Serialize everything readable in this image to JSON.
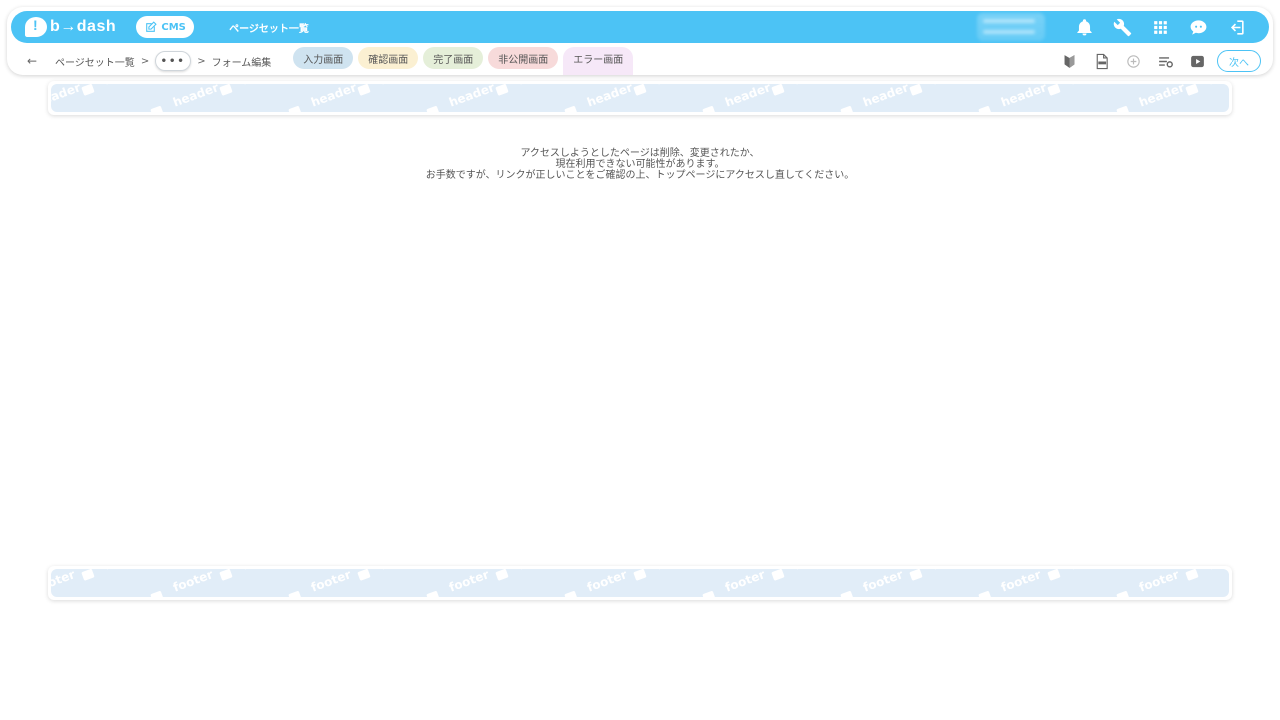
{
  "app": {
    "logo_text": "b→dash",
    "module_chip": "CMS",
    "title": "ページセット一覧"
  },
  "toolbar_icons": [
    "bell-icon",
    "wrench-icon",
    "grid-icon",
    "support-chat-icon",
    "logout-icon"
  ],
  "breadcrumb": {
    "back_icon": "←",
    "root": "ページセット一覧",
    "separator": ">",
    "ellipsis": "•••",
    "current": "フォーム編集"
  },
  "tabs": [
    {
      "label": "入力画面",
      "color": "#cfe3f0"
    },
    {
      "label": "確認画面",
      "color": "#fbf0d2"
    },
    {
      "label": "完了画面",
      "color": "#e5efd9"
    },
    {
      "label": "非公開画面",
      "color": "#f7dada"
    },
    {
      "label": "エラー画面",
      "color": "#f6e8f8",
      "active": true
    }
  ],
  "sub_icons": [
    "beginner-icon",
    "html-file-icon",
    "add-circle-icon",
    "list-settings-icon",
    "play-icon"
  ],
  "next_label": "次へ",
  "header_band": {
    "label": "header"
  },
  "footer_band": {
    "label": "footer"
  },
  "message": {
    "line1": "アクセスしようとしたページは削除、変更されたか、",
    "line2": "現在利用できない可能性があります。",
    "line3": "お手数ですが、リンクが正しいことをご確認の上、トップページにアクセスし直してください。"
  },
  "colors": {
    "accent": "#4cc3f5",
    "band": "#e1edf8"
  }
}
